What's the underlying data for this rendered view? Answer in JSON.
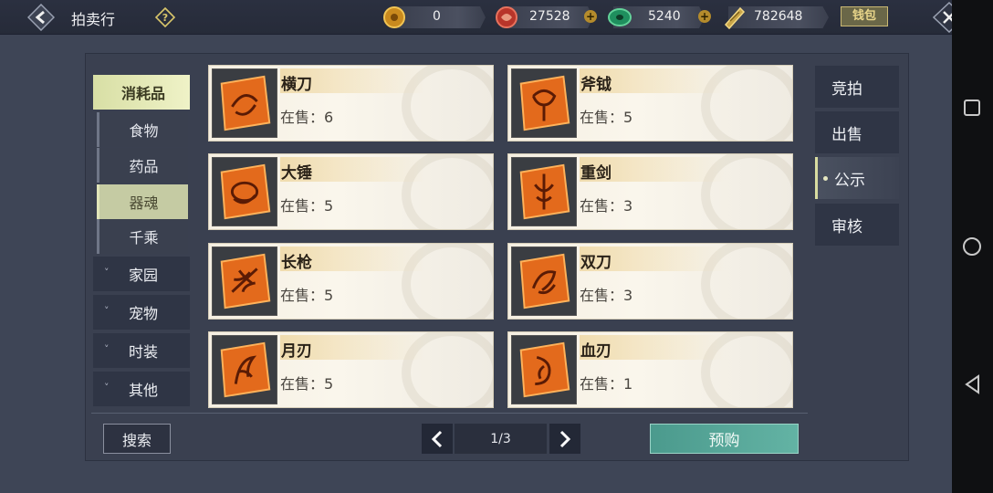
{
  "header": {
    "title": "拍卖行",
    "currencies": [
      {
        "name": "gold-coin-icon",
        "value": "0"
      },
      {
        "name": "red-jade-icon",
        "value": "27528"
      },
      {
        "name": "green-jade-icon",
        "value": "5240"
      },
      {
        "name": "silver-ingot-icon",
        "value": "782648"
      }
    ],
    "wallet_label": "钱包"
  },
  "sidebar": {
    "categories": [
      {
        "label": "消耗品",
        "active": true
      },
      {
        "label": "家园"
      },
      {
        "label": "宠物"
      },
      {
        "label": "时装"
      },
      {
        "label": "其他"
      }
    ],
    "subcategories": [
      {
        "label": "食物"
      },
      {
        "label": "药品"
      },
      {
        "label": "器魂",
        "active": true
      },
      {
        "label": "千乘"
      }
    ]
  },
  "items": [
    {
      "name": "横刀",
      "stock": "在售：6"
    },
    {
      "name": "斧钺",
      "stock": "在售：5"
    },
    {
      "name": "大锤",
      "stock": "在售：5"
    },
    {
      "name": "重剑",
      "stock": "在售：3"
    },
    {
      "name": "长枪",
      "stock": "在售：5"
    },
    {
      "name": "双刀",
      "stock": "在售：3"
    },
    {
      "name": "月刃",
      "stock": "在售：5"
    },
    {
      "name": "血刃",
      "stock": "在售：1"
    }
  ],
  "right_tabs": [
    {
      "label": "竞拍"
    },
    {
      "label": "出售"
    },
    {
      "label": "公示",
      "active": true
    },
    {
      "label": "审核"
    }
  ],
  "footer": {
    "search_label": "搜索",
    "page_indicator": "1/3",
    "preorder_label": "预购"
  },
  "colors": {
    "accent": "#d8dfa5",
    "preorder": "#5aa99a",
    "item_frame": "#e36a1c"
  }
}
